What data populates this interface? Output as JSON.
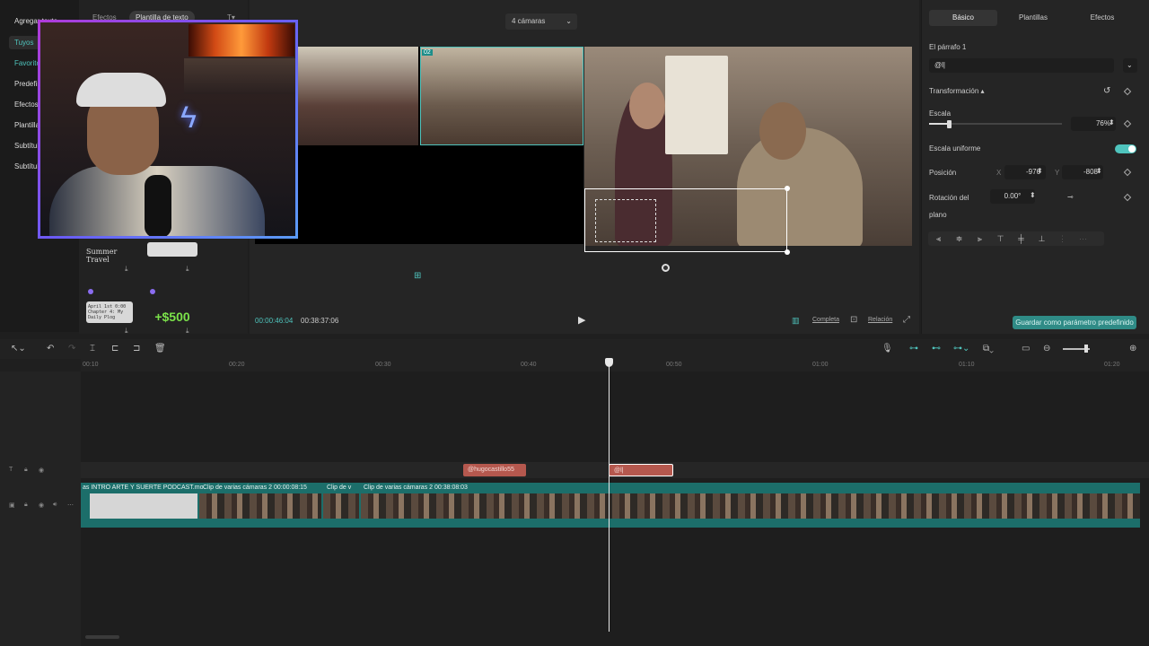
{
  "left_nav": {
    "items": [
      {
        "label": "Agregar texto"
      },
      {
        "label": "Tuyos"
      },
      {
        "label": "Favoritos"
      },
      {
        "label": "Predefinido"
      },
      {
        "label": "Efectos"
      },
      {
        "label": "Plantillas"
      },
      {
        "label": "Subtítulos"
      },
      {
        "label": "Subtítulos"
      }
    ]
  },
  "asset_panel": {
    "tabs": [
      {
        "label": "Efectos"
      },
      {
        "label": "Plantilla de texto"
      }
    ],
    "cards": [
      {
        "text": "Summer Travel"
      },
      {
        "text": ""
      },
      {
        "text": "April 1st 0:00 Chapter 4: My Daily Plog"
      },
      {
        "text": "+$500"
      }
    ]
  },
  "preview": {
    "camera_select": "4 cámaras",
    "cam_numbers": [
      "02"
    ],
    "time_current": "00:00:46:04",
    "time_total": "00:38:37:06",
    "btn_complete": "Completa",
    "btn_ratio": "Relación"
  },
  "inspector": {
    "tabs": [
      {
        "label": "Básico"
      },
      {
        "label": "Plantillas"
      },
      {
        "label": "Efectos"
      }
    ],
    "paragraph_label": "El párrafo 1",
    "paragraph_value": "@l|",
    "transform_label": "Transformación ▴",
    "scale_label": "Escala",
    "scale_value": "76%",
    "scale_fraction": 0.76,
    "uniform_label": "Escala uniforme",
    "position_label": "Posición",
    "pos_x_label": "X",
    "pos_x": "-976",
    "pos_y_label": "Y",
    "pos_y": "-808",
    "rotation_label": "Rotación del",
    "rotation_label2": "plano",
    "rotation_value": "0.00°",
    "save_preset": "Guardar como parámetro predefinido"
  },
  "timeline": {
    "ticks": [
      "00:10",
      "00:20",
      "00:30",
      "00:40",
      "00:50",
      "01:00",
      "01:10",
      "01:20"
    ],
    "text_clips": [
      {
        "label": "@hugocastillo55"
      },
      {
        "label": "@l|"
      }
    ],
    "video_clips": [
      {
        "label": "as INTRO ARTE Y SUERTE PODCAST.mo"
      },
      {
        "label": "Clip de varias cámaras 2 00:00:08:15"
      },
      {
        "label": "Clip de v"
      },
      {
        "label": "Clip de varias cámaras 2 00:38:08:03"
      }
    ]
  },
  "colors": {
    "accent": "#4fc4bd",
    "text_clip": "#b5584e",
    "video_track": "#1c6e6a"
  }
}
